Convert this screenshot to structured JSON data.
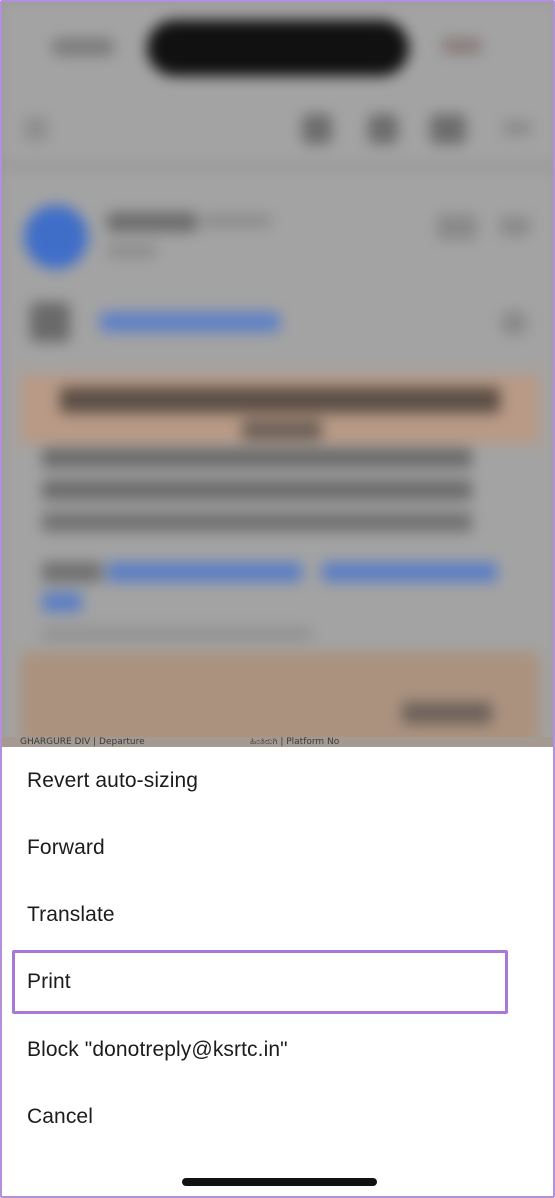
{
  "background_app": {
    "cut_strip_left": "GHARGURE DIV | Departure",
    "cut_strip_mid": "ಹಿಂತಿರುಗಿ | Platform No"
  },
  "action_sheet": {
    "items": [
      {
        "label": "Revert auto-sizing"
      },
      {
        "label": "Forward"
      },
      {
        "label": "Translate"
      },
      {
        "label": "Print"
      },
      {
        "label": "Block \"donotreply@ksrtc.in\""
      },
      {
        "label": "Cancel"
      }
    ],
    "highlighted_item": "Print",
    "highlight_color": "#a77ad8"
  },
  "colors": {
    "frame_border": "#b48fdc",
    "avatar": "#3f6ec9",
    "link": "#5b7ec4"
  }
}
